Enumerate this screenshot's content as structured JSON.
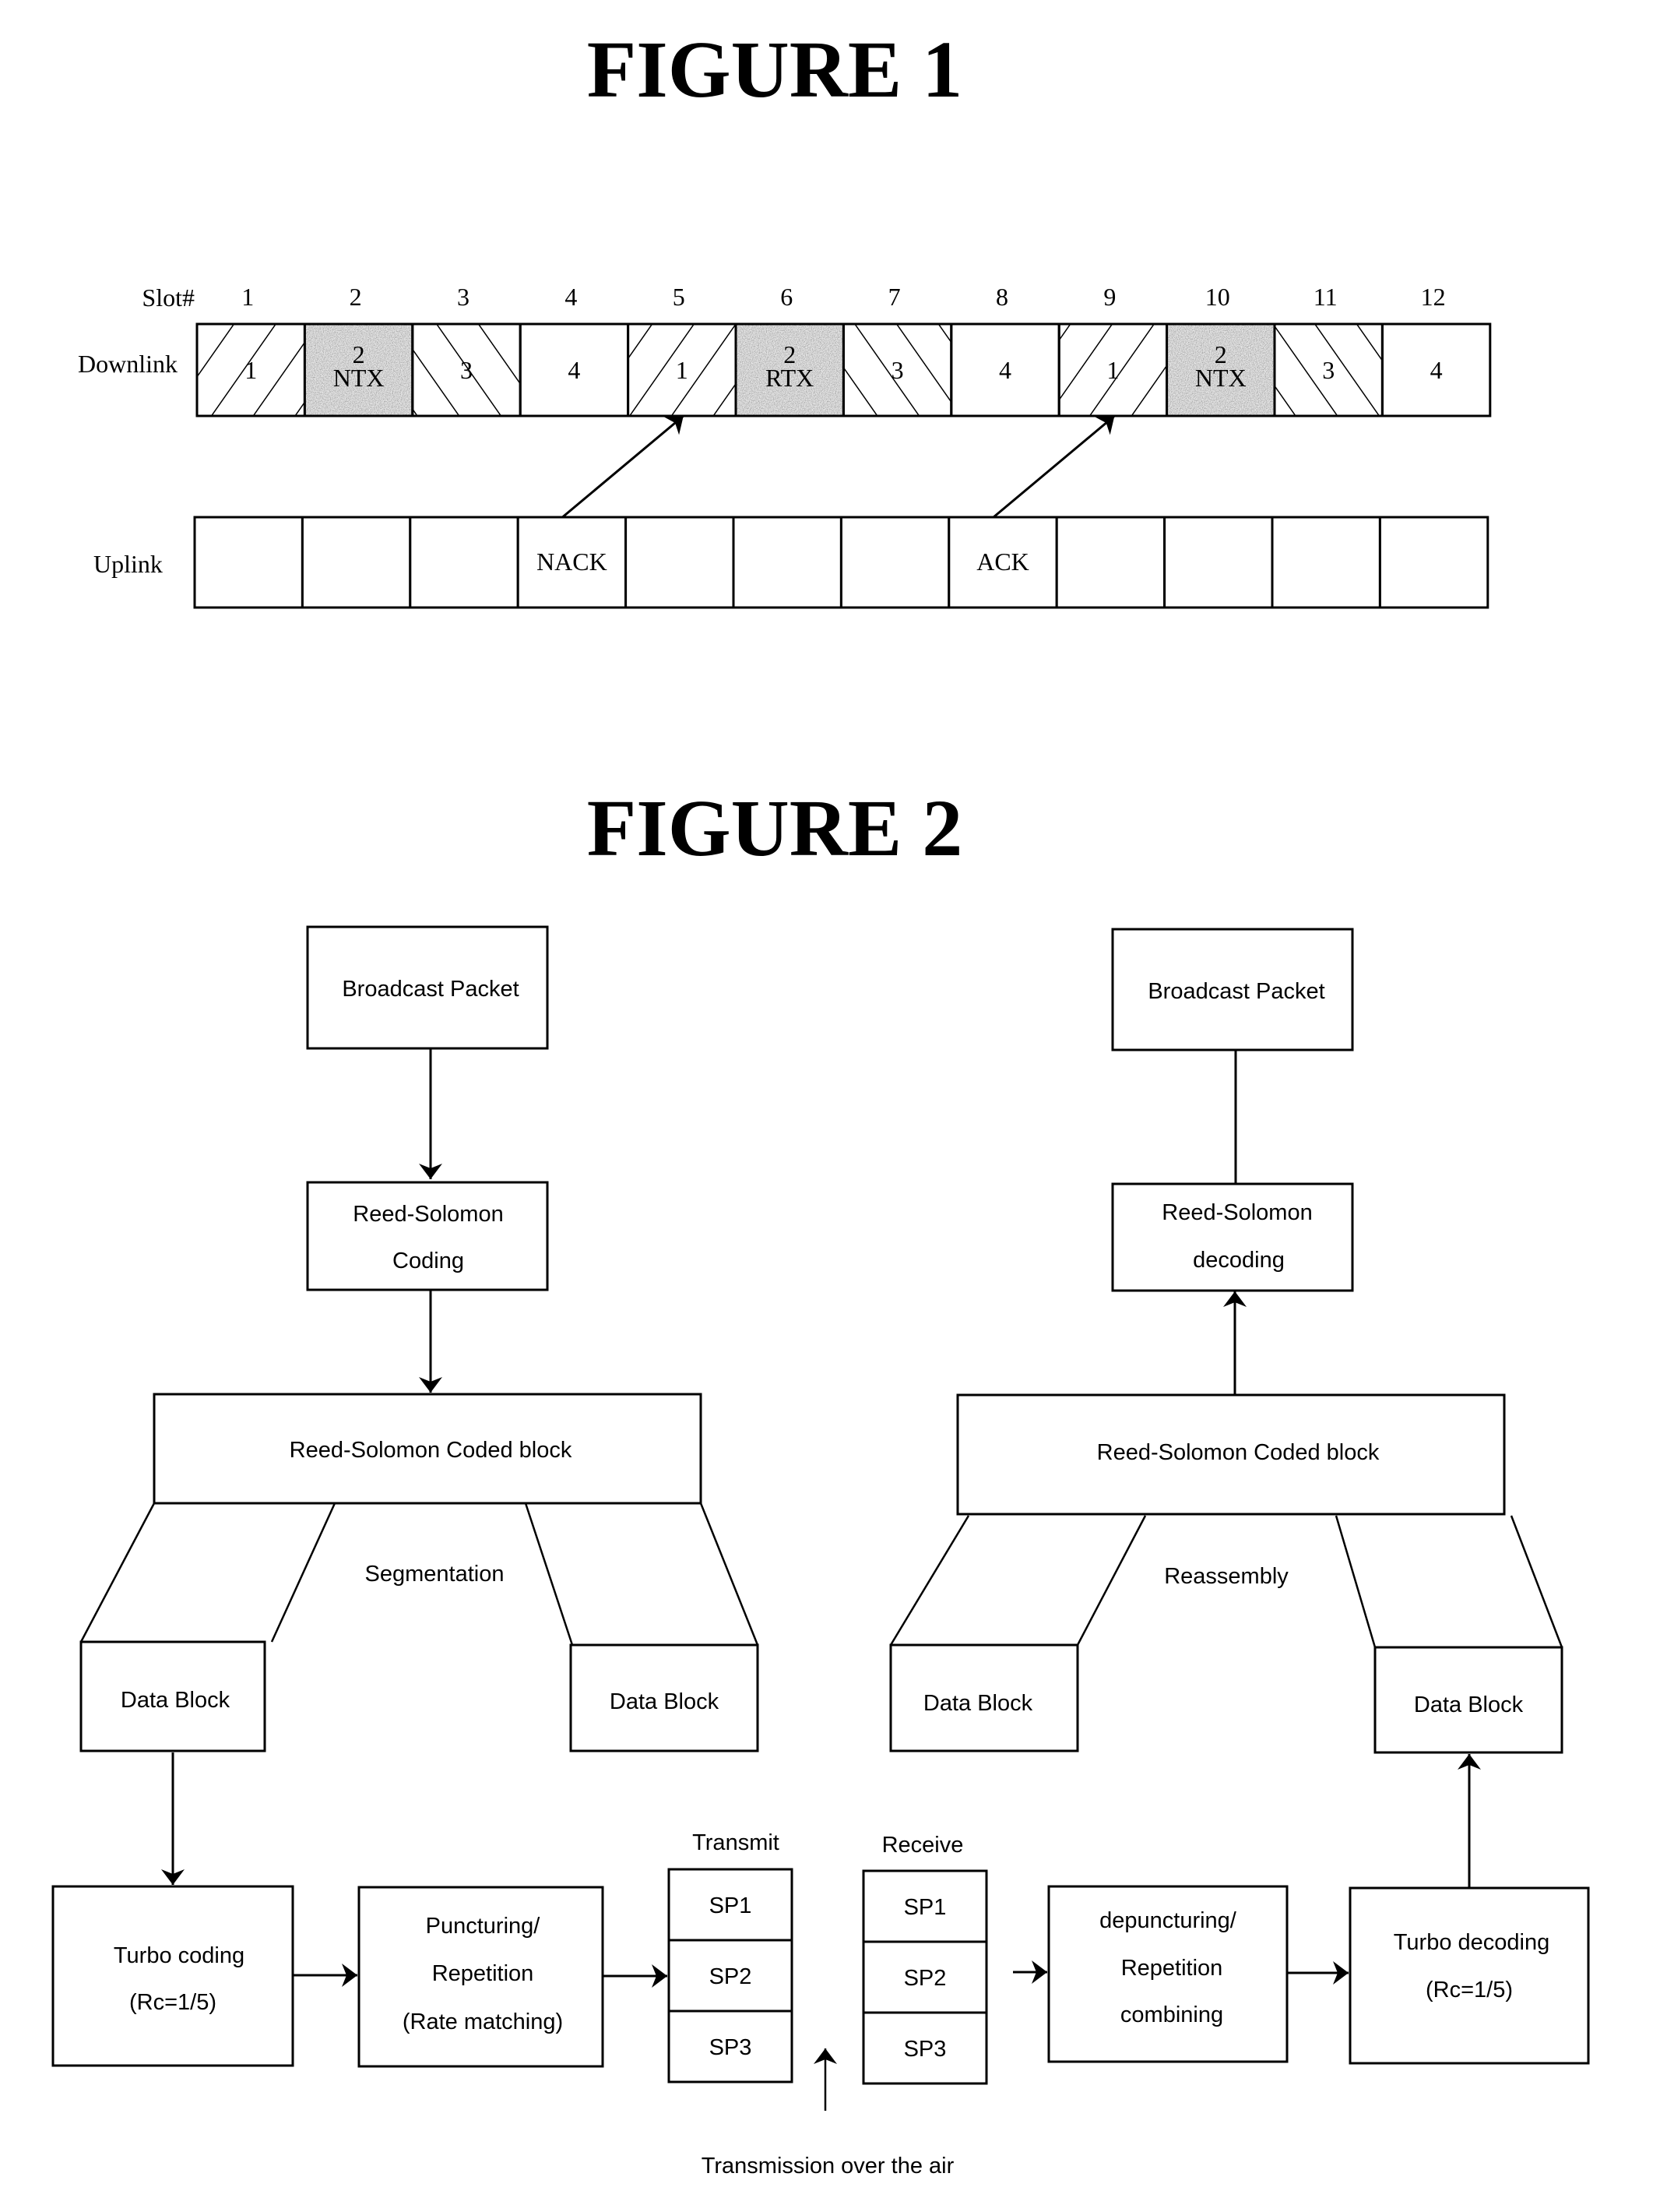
{
  "figure1": {
    "title": "FIGURE 1",
    "slot_label": "Slot#",
    "slots": [
      "1",
      "2",
      "3",
      "4",
      "5",
      "6",
      "7",
      "8",
      "9",
      "10",
      "11",
      "12"
    ],
    "downlink_label": "Downlink",
    "uplink_label": "Uplink",
    "downlink_cells": [
      {
        "line1": "1",
        "line2": "",
        "pattern": "hatch-forward"
      },
      {
        "line1": "2",
        "line2": "NTX",
        "pattern": "stipple"
      },
      {
        "line1": "3",
        "line2": "",
        "pattern": "hatch-back"
      },
      {
        "line1": "4",
        "line2": "",
        "pattern": "none"
      },
      {
        "line1": "1",
        "line2": "",
        "pattern": "hatch-forward"
      },
      {
        "line1": "2",
        "line2": "RTX",
        "pattern": "stipple"
      },
      {
        "line1": "3",
        "line2": "",
        "pattern": "hatch-back"
      },
      {
        "line1": "4",
        "line2": "",
        "pattern": "none"
      },
      {
        "line1": "1",
        "line2": "",
        "pattern": "hatch-forward"
      },
      {
        "line1": "2",
        "line2": "NTX",
        "pattern": "stipple"
      },
      {
        "line1": "3",
        "line2": "",
        "pattern": "hatch-back"
      },
      {
        "line1": "4",
        "line2": "",
        "pattern": "none"
      }
    ],
    "uplink_cells": [
      "",
      "",
      "",
      "NACK",
      "",
      "",
      "",
      "ACK",
      "",
      "",
      "",
      ""
    ],
    "arrows": [
      {
        "from_uplink_slot": 4,
        "to_downlink_slot": 5
      },
      {
        "from_uplink_slot": 8,
        "to_downlink_slot": 9
      }
    ]
  },
  "figure2": {
    "title": "FIGURE 2",
    "tx": {
      "broadcast_packet": "Broadcast Packet",
      "rs_coding": [
        "Reed-Solomon",
        "Coding"
      ],
      "rs_coded_block": "Reed-Solomon Coded block",
      "segmentation": "Segmentation",
      "data_block_left": "Data Block",
      "data_block_right": "Data Block",
      "turbo_coding": [
        "Turbo coding",
        "(Rc=1/5)"
      ],
      "puncturing": [
        "Puncturing/",
        "Repetition",
        "(Rate matching)"
      ],
      "transmit_label": "Transmit",
      "transmit_subpackets": [
        "SP1",
        "SP2",
        "SP3"
      ]
    },
    "rx": {
      "broadcast_packet": "Broadcast Packet",
      "rs_decoding": [
        "Reed-Solomon",
        "decoding"
      ],
      "rs_coded_block": "Reed-Solomon Coded block",
      "reassembly": "Reassembly",
      "data_block_left": "Data Block",
      "data_block_right": "Data Block",
      "turbo_decoding": [
        "Turbo decoding",
        "(Rc=1/5)"
      ],
      "depuncturing": [
        "depuncturing/",
        "Repetition",
        "combining"
      ],
      "receive_label": "Receive",
      "receive_subpackets": [
        "SP1",
        "SP2",
        "SP3"
      ]
    },
    "air_label": "Transmission over the air"
  },
  "colors": {
    "ink": "#000000",
    "paper": "#ffffff",
    "stipple": "#e6e6e6"
  }
}
